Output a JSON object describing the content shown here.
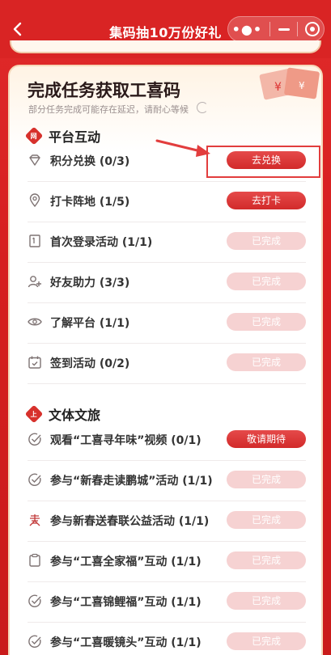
{
  "nav": {
    "title": "集码抽10万份好礼"
  },
  "header": {
    "title": "完成任务获取工喜码",
    "subtitle": "部分任务完成可能存在延迟，请耐心等候"
  },
  "sections": [
    {
      "title": "平台互动",
      "badge": "网"
    },
    {
      "title": "文体文旅",
      "badge": "上"
    }
  ],
  "tasks": [
    {
      "label": "积分兑换  (0/3)",
      "button": "去兑换",
      "state": "active",
      "icon": "diamond-icon"
    },
    {
      "label": "打卡阵地  (1/5)",
      "button": "去打卡",
      "state": "active",
      "icon": "location-pin-icon"
    },
    {
      "label": "首次登录活动  (1/1)",
      "button": "已完成",
      "state": "done",
      "icon": "bookmark-icon"
    },
    {
      "label": "好友助力  (3/3)",
      "button": "已完成",
      "state": "done",
      "icon": "add-friend-icon"
    },
    {
      "label": "了解平台  (1/1)",
      "button": "已完成",
      "state": "done",
      "icon": "eye-icon"
    },
    {
      "label": "签到活动  (0/2)",
      "button": "已完成",
      "state": "done",
      "icon": "calendar-check-icon"
    },
    {
      "label": "观看“工喜寻年味”视频  (0/1)",
      "button": "敬请期待",
      "state": "active",
      "icon": "check-circle-icon"
    },
    {
      "label": "参与“新春走读鹏城”活动  (1/1)",
      "button": "已完成",
      "state": "done",
      "icon": "check-circle-icon"
    },
    {
      "label": "参与新春送春联公益活动  (1/1)",
      "button": "已完成",
      "state": "done",
      "icon": "spring-character-icon"
    },
    {
      "label": "参与“工喜全家福”互动  (1/1)",
      "button": "已完成",
      "state": "done",
      "icon": "clipboard-icon"
    },
    {
      "label": "参与“工喜锦鲤福”互动  (1/1)",
      "button": "已完成",
      "state": "done",
      "icon": "check-circle-icon"
    },
    {
      "label": "参与“工喜暖镜头”互动  (1/1)",
      "button": "已完成",
      "state": "done",
      "icon": "check-circle-icon"
    }
  ],
  "colors": {
    "primary": "#d92424",
    "button_active": "#d22a2a",
    "button_done": "#f6d2d2",
    "highlight": "#e23d3d"
  }
}
